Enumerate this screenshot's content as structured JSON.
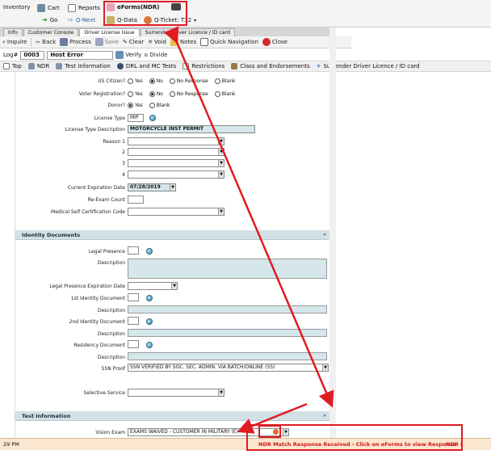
{
  "top_nav": {
    "inventory": "Inventory",
    "cart": "Cart",
    "reports": "Reports",
    "eforms": "eForms(NDR)",
    "go": "Go",
    "q_next": "Q-Next",
    "q_data": "Q-Data",
    "q_ticket": "Q-Ticket: T12"
  },
  "tabs": [
    "Info",
    "Customer Console",
    "Driver License Issue",
    "Surrender Driver Licence / ID card"
  ],
  "toolbar": {
    "inquire": "Inquire",
    "back": "Back",
    "process": "Process",
    "save": "Save",
    "clear": "Clear",
    "void": "Void",
    "notes": "Notes",
    "quick_navigation": "Quick Navigation",
    "close": "Close"
  },
  "log": {
    "label": "Log#",
    "number": "0003",
    "status": "Host Error",
    "verify": "Verify",
    "divide": "Divide"
  },
  "subtabs": [
    "Top",
    "NDR",
    "Test Information",
    "DRL and MC Tests",
    "Restrictions",
    "Class and Endorsements",
    "Surrender Driver Licence / ID card"
  ],
  "form": {
    "us_citizen": {
      "label": "US Citizen?",
      "options": [
        "Yes",
        "No",
        "No Response",
        "Blank"
      ],
      "selected": "No"
    },
    "voter_registration": {
      "label": "Voter Registration?",
      "options": [
        "Yes",
        "No",
        "No Response",
        "Blank"
      ],
      "selected": "No"
    },
    "donor": {
      "label": "Donor?",
      "options": [
        "Yes",
        "Blank"
      ],
      "selected": "Yes"
    },
    "license_type": {
      "label": "License Type",
      "value": "MIP"
    },
    "license_type_description": {
      "label": "License Type Description",
      "value": "MOTORCYCLE INST PERMIT"
    },
    "reasons": [
      {
        "label": "Reason 1"
      },
      {
        "label": "2"
      },
      {
        "label": "3"
      },
      {
        "label": "4"
      }
    ],
    "current_expiration_date": {
      "label": "Current Expiration Date",
      "value": "07/28/2019"
    },
    "re_exam_count": {
      "label": "Re-Exam Count"
    },
    "medical_self_certification_code": {
      "label": "Medical Self Certification Code"
    }
  },
  "identity_documents": {
    "title": "Identity Documents",
    "legal_presence": "Legal Presence",
    "description": "Description",
    "legal_presence_expiration_date": "Legal Presence Expiration Date",
    "first_identity_document": "1st Identity Document",
    "second_identity_document": "2nd Identity Document",
    "residency_document": "Residency Document",
    "ssn_proof": {
      "label": "SSN Proof",
      "value": "SSN VERIFIED BY SOC. SEC. ADMIN. VIA BATCH/ONLINE (SS)"
    },
    "selective_service": "Selective Service"
  },
  "test_information": {
    "title": "Test Information",
    "vision_exam": {
      "label": "Vision Exam",
      "value": "EXAMS WAIVED - CUSTOMER IN MILITARY (E)"
    }
  },
  "status": {
    "time": "29 PM",
    "message": "NDR Match Response Received - Click on eForms to view Response",
    "right_label": "NDR I"
  },
  "colors": {
    "accent_red": "#e01b22",
    "status_bg": "#fbe6cf",
    "readonly_bg": "#d5e7ea",
    "section_bg": "#d3e0e6"
  }
}
